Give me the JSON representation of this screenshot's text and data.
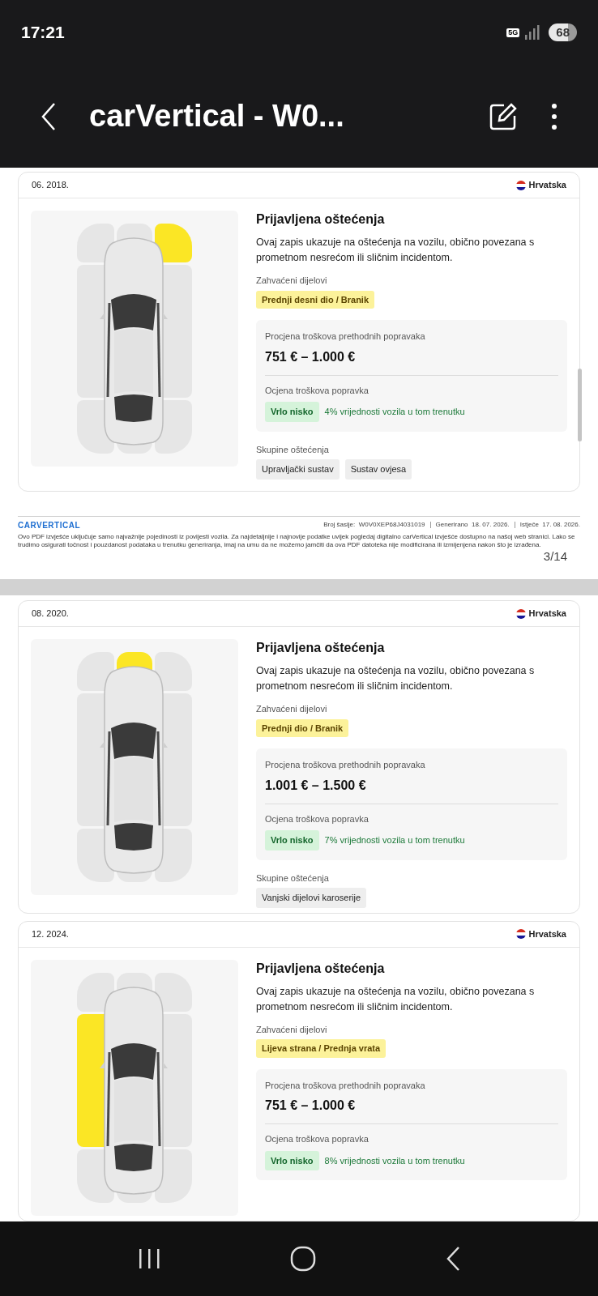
{
  "status_bar": {
    "time": "17:21",
    "network": "5G",
    "battery": "68"
  },
  "app_bar": {
    "title": "carVertical - W0..."
  },
  "pages": [
    {
      "records": [
        {
          "date": "06. 2018.",
          "country": "Hrvatska",
          "title": "Prijavljena oštećenja",
          "description": "Ovaj zapis ukazuje na oštećenja na vozilu, obično povezana s prometnom nesrećom ili sličnim incidentom.",
          "affected_label": "Zahvaćeni dijelovi",
          "affected_part": "Prednji desni dio / Branik",
          "zones": [
            false,
            false,
            true,
            false,
            false,
            false,
            false,
            false
          ],
          "cost_label": "Procjena troškova prethodnih popravaka",
          "cost_range": "751 € – 1.000 €",
          "rating_label": "Ocjena troškova popravka",
          "rating": "Vrlo nisko",
          "rating_note": "4% vrijednosti vozila u tom trenutku",
          "groups_label": "Skupine oštećenja",
          "groups": [
            "Upravljački sustav",
            "Sustav ovjesa"
          ]
        }
      ],
      "footer": {
        "logo": "CARVERTICAL",
        "chassis": "Broj šasije:  W0V0XEP68J4031019",
        "generated": "Generirano  18. 07. 2026.",
        "expires": "Istječe  17. 08. 2026.",
        "disclaimer": "Ovo PDF izvješće uključuje samo najvažnije pojedinosti iz povijesti vozila. Za najdetaljnije i najnovije podatke uvijek pogledaj digitalno carVertical izvješće dostupno na našoj web stranici. Lako se trudimo osigurati točnost i pouzdanost podataka u trenutku generiranja, imaj na umu da ne možemo jamčiti da ova PDF datoteka nije modificirana ili izmijenjena nakon što je izrađena.",
        "page_number": "3/14"
      }
    },
    {
      "records": [
        {
          "date": "08. 2020.",
          "country": "Hrvatska",
          "title": "Prijavljena oštećenja",
          "description": "Ovaj zapis ukazuje na oštećenja na vozilu, obično povezana s prometnom nesrećom ili sličnim incidentom.",
          "affected_label": "Zahvaćeni dijelovi",
          "affected_part": "Prednji dio / Branik",
          "zones": [
            false,
            true,
            false,
            false,
            false,
            false,
            false,
            false
          ],
          "cost_label": "Procjena troškova prethodnih popravaka",
          "cost_range": "1.001 € – 1.500 €",
          "rating_label": "Ocjena troškova popravka",
          "rating": "Vrlo nisko",
          "rating_note": "7% vrijednosti vozila u tom trenutku",
          "groups_label": "Skupine oštećenja",
          "groups": [
            "Vanjski dijelovi karoserije"
          ]
        },
        {
          "date": "12. 2024.",
          "country": "Hrvatska",
          "title": "Prijavljena oštećenja",
          "description": "Ovaj zapis ukazuje na oštećenja na vozilu, obično povezana s prometnom nesrećom ili sličnim incidentom.",
          "affected_label": "Zahvaćeni dijelovi",
          "affected_part": "Lijeva strana / Prednja vrata",
          "zones": [
            false,
            false,
            false,
            true,
            false,
            false,
            false,
            false
          ],
          "cost_label": "Procjena troškova prethodnih popravaka",
          "cost_range": "751 € – 1.000 €",
          "rating_label": "Ocjena troškova popravka",
          "rating": "Vrlo nisko",
          "rating_note": "8% vrijednosti vozila u tom trenutku"
        }
      ]
    }
  ]
}
